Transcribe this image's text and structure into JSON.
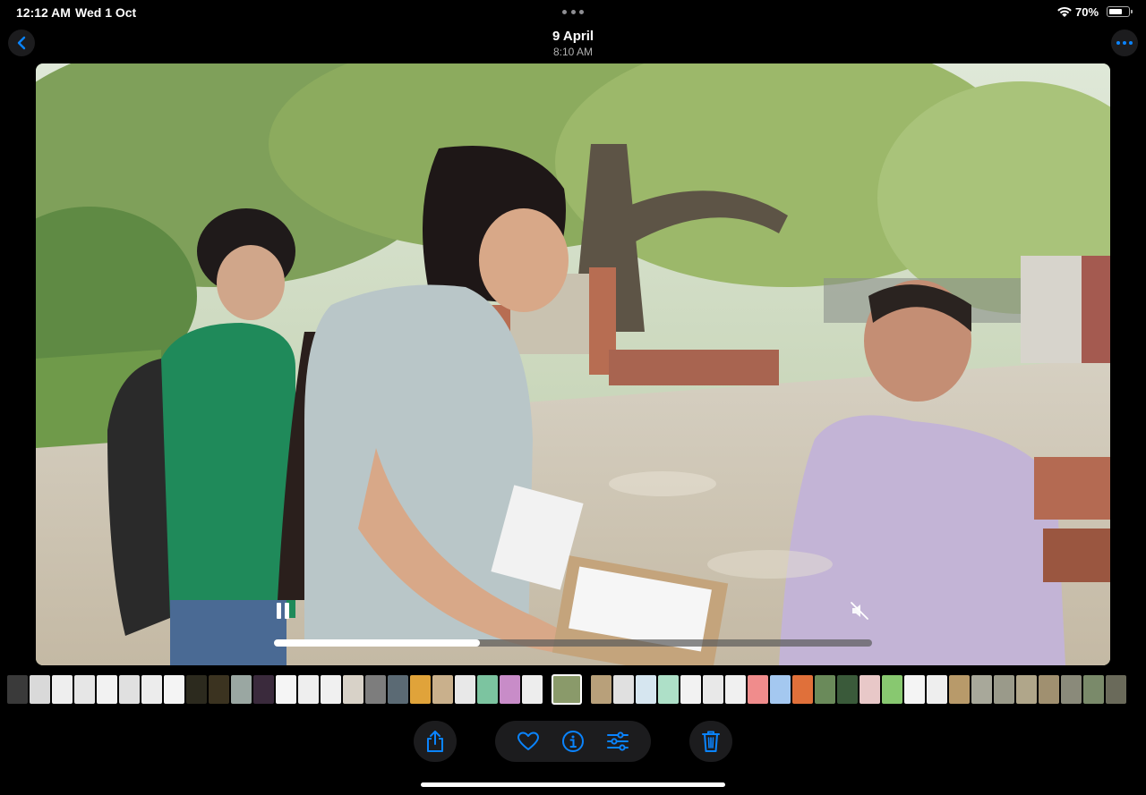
{
  "status_bar": {
    "time": "12:12 AM",
    "date": "Wed 1 Oct",
    "battery_percent": "70%",
    "battery_level": 0.7,
    "wifi_icon": "wifi-icon"
  },
  "nav": {
    "title": "9 April",
    "subtitle": "8:10 AM",
    "back_icon": "chevron-left-icon",
    "more_icon": "ellipsis-icon"
  },
  "video": {
    "playback_progress": 0.345,
    "state": "playing",
    "muted": true
  },
  "filmstrip": {
    "thumbnails": [
      {
        "color": "#3a3a3a"
      },
      {
        "color": "#d9d9d9"
      },
      {
        "color": "#eeeeee"
      },
      {
        "color": "#e6e6e6"
      },
      {
        "color": "#f2f2f2"
      },
      {
        "color": "#e0e0e0"
      },
      {
        "color": "#ececec"
      },
      {
        "color": "#f4f4f4"
      },
      {
        "color": "#2c2a1e"
      },
      {
        "color": "#3b3320"
      },
      {
        "color": "#9aa7a2"
      },
      {
        "color": "#3a2a3c"
      },
      {
        "color": "#f5f5f5"
      },
      {
        "color": "#eeeeee"
      },
      {
        "color": "#f0f0f0"
      },
      {
        "color": "#d8d2c8"
      },
      {
        "color": "#7d7d7d"
      },
      {
        "color": "#5b6a74"
      },
      {
        "color": "#e0a33a"
      },
      {
        "color": "#c9b08c"
      },
      {
        "color": "#e8e8e8"
      },
      {
        "color": "#7cc4a0"
      },
      {
        "color": "#c88cc8"
      },
      {
        "color": "#ededed"
      },
      {
        "color": "#8a9a6a",
        "current": true
      },
      {
        "color": "#b8a07a"
      },
      {
        "color": "#e0e0e0"
      },
      {
        "color": "#d6e6f0"
      },
      {
        "color": "#aee0c8"
      },
      {
        "color": "#f2f2f2"
      },
      {
        "color": "#e8e8e8"
      },
      {
        "color": "#f0f0f0"
      },
      {
        "color": "#f08c8c"
      },
      {
        "color": "#a4c8f0"
      },
      {
        "color": "#e0703a"
      },
      {
        "color": "#6a8a5a"
      },
      {
        "color": "#3a5a3a"
      },
      {
        "color": "#e8c8c8"
      },
      {
        "color": "#88c870"
      },
      {
        "color": "#f4f4f4"
      },
      {
        "color": "#eeeeee"
      },
      {
        "color": "#b89a6a"
      },
      {
        "color": "#a8a89a"
      },
      {
        "color": "#9a9a8a"
      },
      {
        "color": "#b0a68a"
      },
      {
        "color": "#a09070"
      },
      {
        "color": "#8a8a7a"
      },
      {
        "color": "#7a8a6a"
      },
      {
        "color": "#6a6a5a"
      }
    ]
  },
  "toolbar": {
    "share_icon": "share-icon",
    "favorite_icon": "heart-icon",
    "info_icon": "info-icon",
    "adjust_icon": "sliders-icon",
    "delete_icon": "trash-icon"
  },
  "colors": {
    "accent": "#0a84ff",
    "button_bg": "#1c1c1e",
    "background": "#000000"
  }
}
